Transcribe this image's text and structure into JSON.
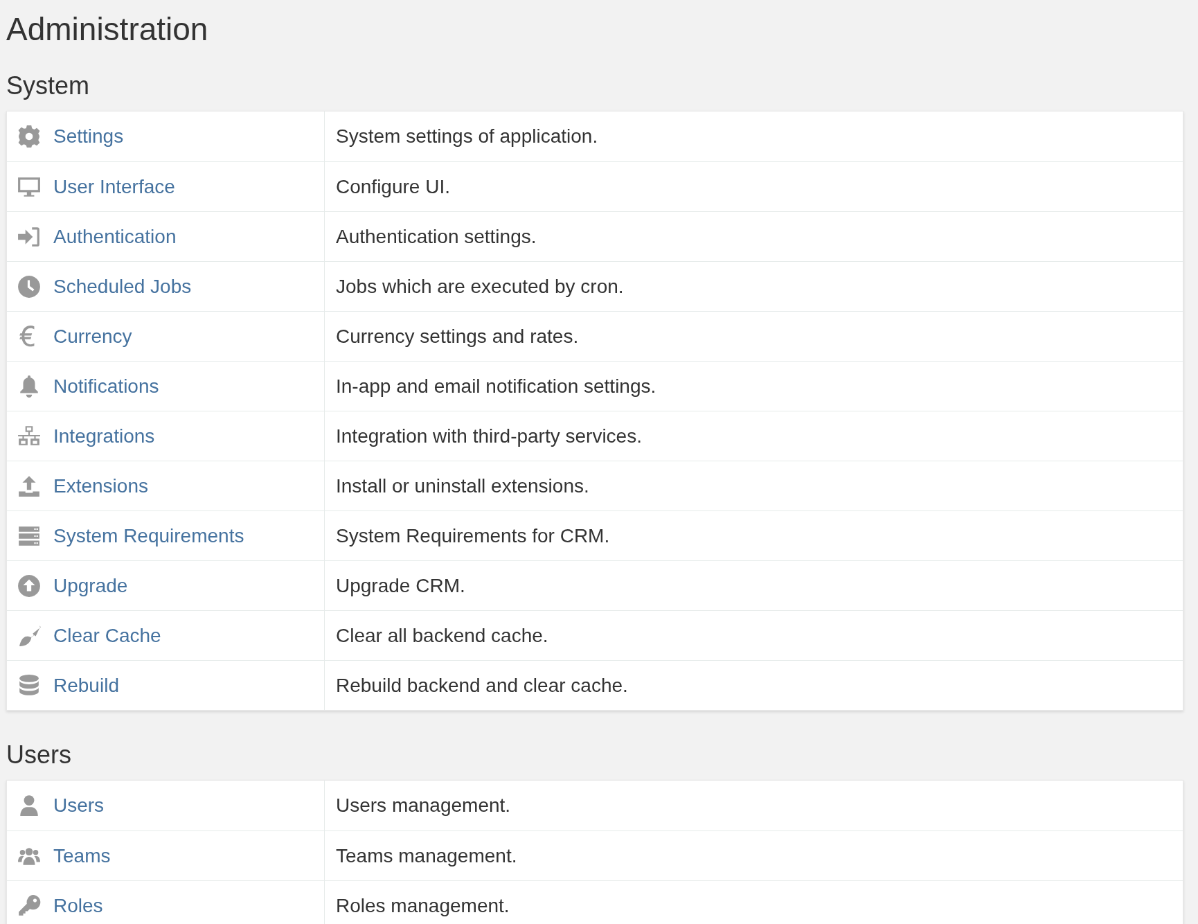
{
  "title": "Administration",
  "sections": [
    {
      "heading": "System",
      "rows": [
        {
          "label": "Settings",
          "description": "System settings of application."
        },
        {
          "label": "User Interface",
          "description": "Configure UI."
        },
        {
          "label": "Authentication",
          "description": "Authentication settings."
        },
        {
          "label": "Scheduled Jobs",
          "description": "Jobs which are executed by cron."
        },
        {
          "label": "Currency",
          "description": "Currency settings and rates."
        },
        {
          "label": "Notifications",
          "description": "In-app and email notification settings."
        },
        {
          "label": "Integrations",
          "description": "Integration with third-party services."
        },
        {
          "label": "Extensions",
          "description": "Install or uninstall extensions."
        },
        {
          "label": "System Requirements",
          "description": "System Requirements for CRM."
        },
        {
          "label": "Upgrade",
          "description": "Upgrade CRM."
        },
        {
          "label": "Clear Cache",
          "description": "Clear all backend cache."
        },
        {
          "label": "Rebuild",
          "description": "Rebuild backend and clear cache."
        }
      ]
    },
    {
      "heading": "Users",
      "rows": [
        {
          "label": "Users",
          "description": "Users management."
        },
        {
          "label": "Teams",
          "description": "Teams management."
        },
        {
          "label": "Roles",
          "description": "Roles management."
        }
      ]
    }
  ]
}
